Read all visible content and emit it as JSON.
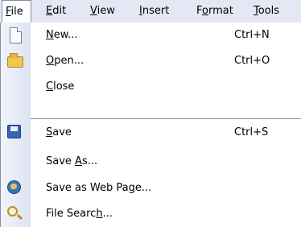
{
  "menubar": {
    "items": [
      {
        "pre": "",
        "u": "F",
        "post": "ile"
      },
      {
        "pre": "",
        "u": "E",
        "post": "dit"
      },
      {
        "pre": "",
        "u": "V",
        "post": "iew"
      },
      {
        "pre": "",
        "u": "I",
        "post": "nsert"
      },
      {
        "pre": "F",
        "u": "o",
        "post": "rmat"
      },
      {
        "pre": "",
        "u": "T",
        "post": "ools"
      }
    ]
  },
  "file_menu": {
    "items": [
      {
        "icon": "new-document-icon",
        "pre": "",
        "u": "N",
        "post": "ew...",
        "shortcut": "Ctrl+N"
      },
      {
        "icon": "open-folder-icon",
        "pre": "",
        "u": "O",
        "post": "pen...",
        "shortcut": "Ctrl+O"
      },
      {
        "icon": "",
        "pre": "",
        "u": "C",
        "post": "lose",
        "shortcut": ""
      },
      {
        "icon": "save-disk-icon",
        "pre": "",
        "u": "S",
        "post": "ave",
        "shortcut": "Ctrl+S"
      },
      {
        "icon": "",
        "pre": "Save ",
        "u": "A",
        "post": "s...",
        "shortcut": ""
      },
      {
        "icon": "web-page-icon",
        "pre": "Save as Web Pa",
        "u": "g",
        "post": "e...",
        "shortcut": ""
      },
      {
        "icon": "file-search-icon",
        "pre": "File Searc",
        "u": "h",
        "post": "...",
        "shortcut": ""
      }
    ]
  }
}
